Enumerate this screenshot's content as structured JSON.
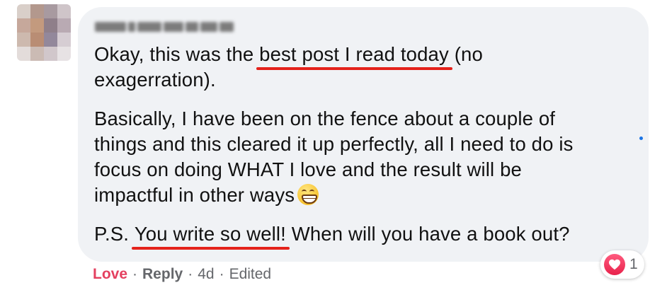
{
  "comment": {
    "author_name": "",
    "paragraphs": [
      {
        "lines": [
          {
            "before": "Okay, this was the ",
            "highlight": "best post I read today",
            "after": " (no"
          },
          {
            "text": "exagerration)."
          }
        ]
      },
      {
        "lines": [
          "Basically, I have been on the fence about a couple of",
          "things and this cleared it up perfectly, all I need to do is",
          "focus on doing WHAT I love and the result will be",
          "impactful in other ways"
        ],
        "trailing_emoji": "grinning-face-with-smiling-eyes"
      },
      {
        "lines": [
          {
            "before": "P.S. ",
            "highlight": "You write so well!",
            "after": " When will you have a book out?"
          }
        ]
      }
    ],
    "highlight_color": "#e4221b"
  },
  "actions": {
    "love_label": "Love",
    "reply_label": "Reply",
    "separator": "·",
    "time": "4d",
    "edited_label": "Edited",
    "love_color": "#e4405f"
  },
  "reaction": {
    "icon": "heart-icon",
    "count": "1",
    "color": "#e8224b"
  },
  "colors": {
    "bubble": "#f0f2f5",
    "text": "#111111",
    "meta": "#65676b",
    "unread_dot": "#1b74e4"
  }
}
